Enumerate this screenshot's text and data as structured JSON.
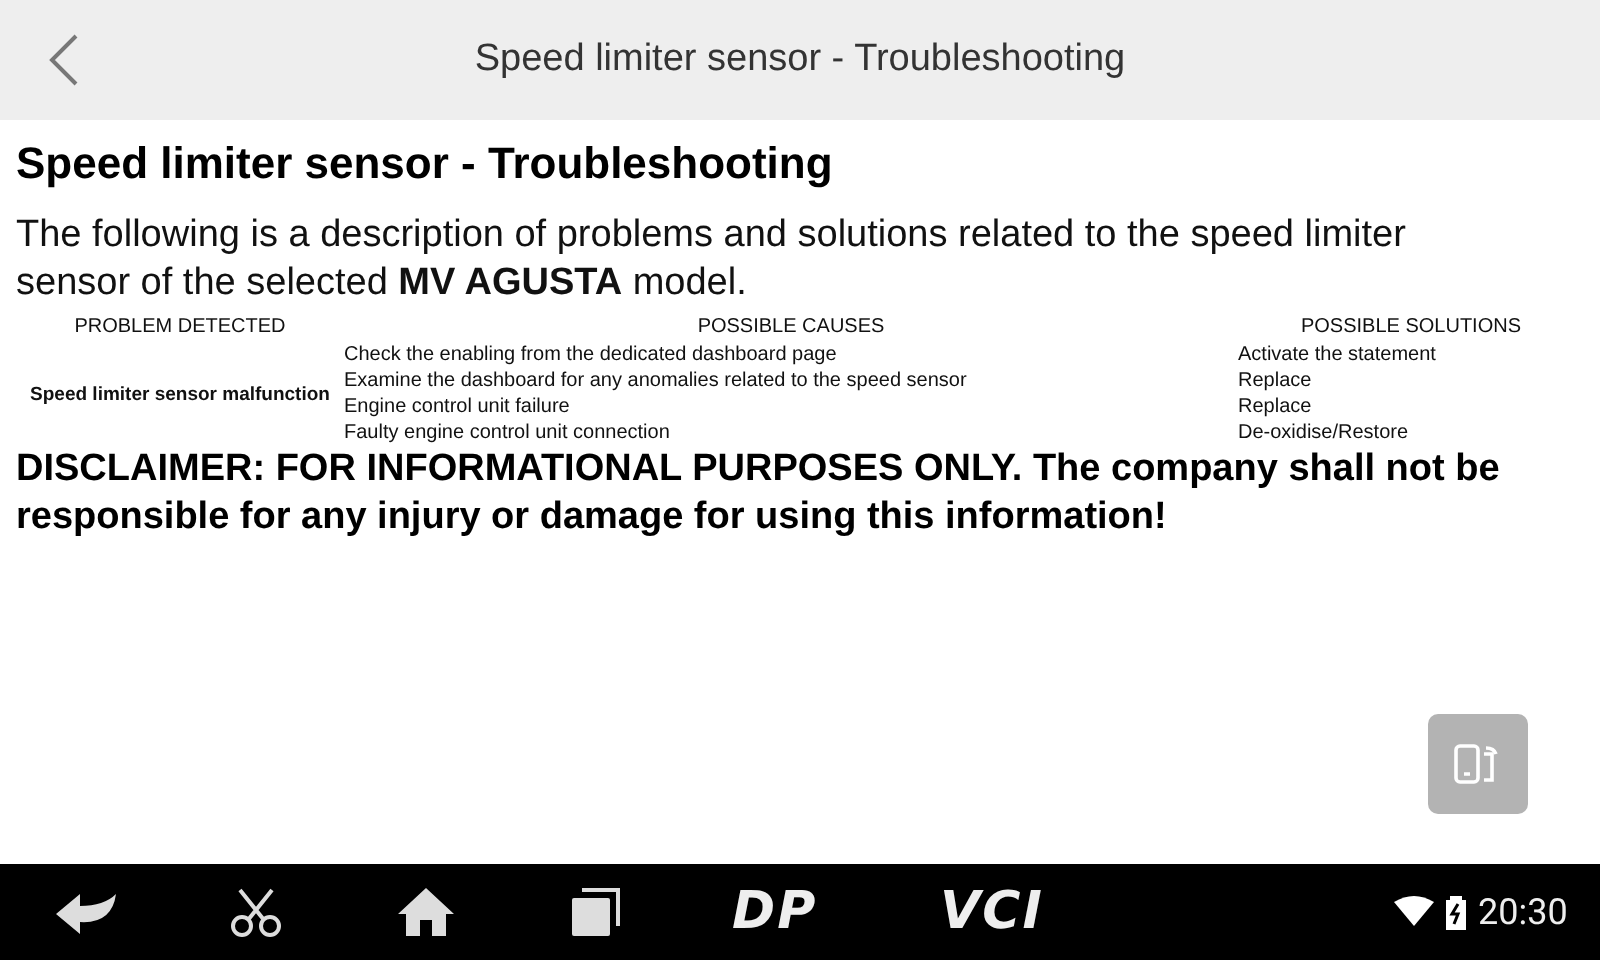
{
  "header": {
    "title": "Speed limiter sensor - Troubleshooting"
  },
  "heading": "Speed limiter sensor - Troubleshooting",
  "description": "The following is a description of problems and solutions related to the speed limiter sensor of the selected **MV AGUSTA** model.",
  "table": {
    "columns": [
      "PROBLEM DETECTED",
      "POSSIBLE CAUSES",
      "POSSIBLE SOLUTIONS"
    ],
    "rows": [
      {
        "problem": "Speed limiter sensor malfunction",
        "causes": [
          "Check the enabling from the dedicated dashboard page",
          "Examine the dashboard for any anomalies related to the speed sensor",
          "Engine control unit failure",
          "Faulty engine control unit connection"
        ],
        "solutions": [
          "Activate the statement",
          "Replace",
          "Replace",
          "De-oxidise/Restore"
        ]
      }
    ]
  },
  "disclaimer": "DISCLAIMER: FOR INFORMATIONAL PURPOSES ONLY. The company shall not be responsible for any injury or damage for using this information!",
  "navbar": {
    "logos": [
      "DP",
      "VCI"
    ],
    "time": "20:30"
  }
}
